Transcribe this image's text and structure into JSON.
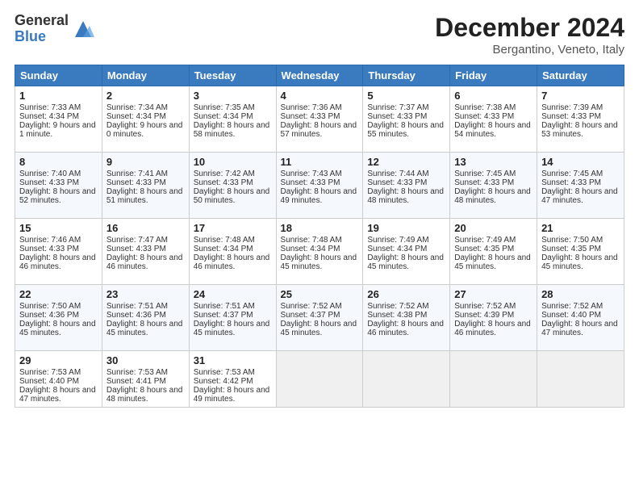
{
  "logo": {
    "general": "General",
    "blue": "Blue"
  },
  "title": "December 2024",
  "subtitle": "Bergantino, Veneto, Italy",
  "days": [
    "Sunday",
    "Monday",
    "Tuesday",
    "Wednesday",
    "Thursday",
    "Friday",
    "Saturday"
  ],
  "weeks": [
    [
      {
        "num": "1",
        "sunrise": "Sunrise: 7:33 AM",
        "sunset": "Sunset: 4:34 PM",
        "daylight": "Daylight: 9 hours and 1 minute."
      },
      {
        "num": "2",
        "sunrise": "Sunrise: 7:34 AM",
        "sunset": "Sunset: 4:34 PM",
        "daylight": "Daylight: 9 hours and 0 minutes."
      },
      {
        "num": "3",
        "sunrise": "Sunrise: 7:35 AM",
        "sunset": "Sunset: 4:34 PM",
        "daylight": "Daylight: 8 hours and 58 minutes."
      },
      {
        "num": "4",
        "sunrise": "Sunrise: 7:36 AM",
        "sunset": "Sunset: 4:33 PM",
        "daylight": "Daylight: 8 hours and 57 minutes."
      },
      {
        "num": "5",
        "sunrise": "Sunrise: 7:37 AM",
        "sunset": "Sunset: 4:33 PM",
        "daylight": "Daylight: 8 hours and 55 minutes."
      },
      {
        "num": "6",
        "sunrise": "Sunrise: 7:38 AM",
        "sunset": "Sunset: 4:33 PM",
        "daylight": "Daylight: 8 hours and 54 minutes."
      },
      {
        "num": "7",
        "sunrise": "Sunrise: 7:39 AM",
        "sunset": "Sunset: 4:33 PM",
        "daylight": "Daylight: 8 hours and 53 minutes."
      }
    ],
    [
      {
        "num": "8",
        "sunrise": "Sunrise: 7:40 AM",
        "sunset": "Sunset: 4:33 PM",
        "daylight": "Daylight: 8 hours and 52 minutes."
      },
      {
        "num": "9",
        "sunrise": "Sunrise: 7:41 AM",
        "sunset": "Sunset: 4:33 PM",
        "daylight": "Daylight: 8 hours and 51 minutes."
      },
      {
        "num": "10",
        "sunrise": "Sunrise: 7:42 AM",
        "sunset": "Sunset: 4:33 PM",
        "daylight": "Daylight: 8 hours and 50 minutes."
      },
      {
        "num": "11",
        "sunrise": "Sunrise: 7:43 AM",
        "sunset": "Sunset: 4:33 PM",
        "daylight": "Daylight: 8 hours and 49 minutes."
      },
      {
        "num": "12",
        "sunrise": "Sunrise: 7:44 AM",
        "sunset": "Sunset: 4:33 PM",
        "daylight": "Daylight: 8 hours and 48 minutes."
      },
      {
        "num": "13",
        "sunrise": "Sunrise: 7:45 AM",
        "sunset": "Sunset: 4:33 PM",
        "daylight": "Daylight: 8 hours and 48 minutes."
      },
      {
        "num": "14",
        "sunrise": "Sunrise: 7:45 AM",
        "sunset": "Sunset: 4:33 PM",
        "daylight": "Daylight: 8 hours and 47 minutes."
      }
    ],
    [
      {
        "num": "15",
        "sunrise": "Sunrise: 7:46 AM",
        "sunset": "Sunset: 4:33 PM",
        "daylight": "Daylight: 8 hours and 46 minutes."
      },
      {
        "num": "16",
        "sunrise": "Sunrise: 7:47 AM",
        "sunset": "Sunset: 4:33 PM",
        "daylight": "Daylight: 8 hours and 46 minutes."
      },
      {
        "num": "17",
        "sunrise": "Sunrise: 7:48 AM",
        "sunset": "Sunset: 4:34 PM",
        "daylight": "Daylight: 8 hours and 46 minutes."
      },
      {
        "num": "18",
        "sunrise": "Sunrise: 7:48 AM",
        "sunset": "Sunset: 4:34 PM",
        "daylight": "Daylight: 8 hours and 45 minutes."
      },
      {
        "num": "19",
        "sunrise": "Sunrise: 7:49 AM",
        "sunset": "Sunset: 4:34 PM",
        "daylight": "Daylight: 8 hours and 45 minutes."
      },
      {
        "num": "20",
        "sunrise": "Sunrise: 7:49 AM",
        "sunset": "Sunset: 4:35 PM",
        "daylight": "Daylight: 8 hours and 45 minutes."
      },
      {
        "num": "21",
        "sunrise": "Sunrise: 7:50 AM",
        "sunset": "Sunset: 4:35 PM",
        "daylight": "Daylight: 8 hours and 45 minutes."
      }
    ],
    [
      {
        "num": "22",
        "sunrise": "Sunrise: 7:50 AM",
        "sunset": "Sunset: 4:36 PM",
        "daylight": "Daylight: 8 hours and 45 minutes."
      },
      {
        "num": "23",
        "sunrise": "Sunrise: 7:51 AM",
        "sunset": "Sunset: 4:36 PM",
        "daylight": "Daylight: 8 hours and 45 minutes."
      },
      {
        "num": "24",
        "sunrise": "Sunrise: 7:51 AM",
        "sunset": "Sunset: 4:37 PM",
        "daylight": "Daylight: 8 hours and 45 minutes."
      },
      {
        "num": "25",
        "sunrise": "Sunrise: 7:52 AM",
        "sunset": "Sunset: 4:37 PM",
        "daylight": "Daylight: 8 hours and 45 minutes."
      },
      {
        "num": "26",
        "sunrise": "Sunrise: 7:52 AM",
        "sunset": "Sunset: 4:38 PM",
        "daylight": "Daylight: 8 hours and 46 minutes."
      },
      {
        "num": "27",
        "sunrise": "Sunrise: 7:52 AM",
        "sunset": "Sunset: 4:39 PM",
        "daylight": "Daylight: 8 hours and 46 minutes."
      },
      {
        "num": "28",
        "sunrise": "Sunrise: 7:52 AM",
        "sunset": "Sunset: 4:40 PM",
        "daylight": "Daylight: 8 hours and 47 minutes."
      }
    ],
    [
      {
        "num": "29",
        "sunrise": "Sunrise: 7:53 AM",
        "sunset": "Sunset: 4:40 PM",
        "daylight": "Daylight: 8 hours and 47 minutes."
      },
      {
        "num": "30",
        "sunrise": "Sunrise: 7:53 AM",
        "sunset": "Sunset: 4:41 PM",
        "daylight": "Daylight: 8 hours and 48 minutes."
      },
      {
        "num": "31",
        "sunrise": "Sunrise: 7:53 AM",
        "sunset": "Sunset: 4:42 PM",
        "daylight": "Daylight: 8 hours and 49 minutes."
      },
      null,
      null,
      null,
      null
    ]
  ]
}
